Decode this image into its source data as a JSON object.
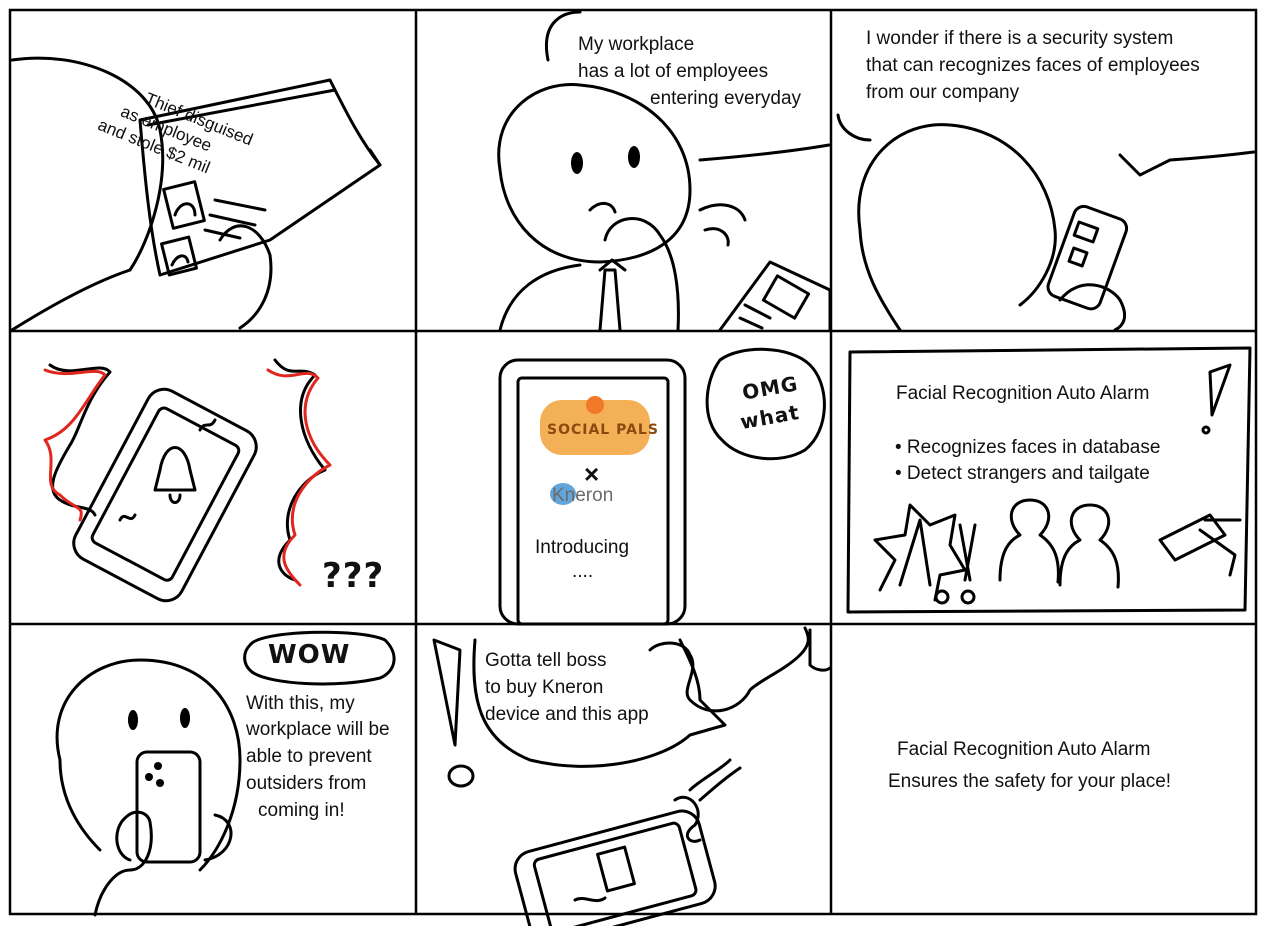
{
  "panel1": {
    "newspaper_headline": [
      "Thief disguised",
      "as employee",
      "and stole $2 mil"
    ]
  },
  "panel2": {
    "speech": [
      "My workplace",
      "has a lot of employees",
      "entering everyday"
    ]
  },
  "panel3": {
    "speech": [
      "I wonder if there is a security system",
      "that can recognizes faces of employees",
      "from our company"
    ]
  },
  "panel4": {
    "sound_text": "???"
  },
  "panel5": {
    "logo_socialpals": "SOCIAL PALS",
    "cross": "×",
    "logo_kneron": "Kneron",
    "caption": "Introducing",
    "ellipsis": "....",
    "thought": [
      "OMG",
      "what"
    ]
  },
  "panel6": {
    "title": "Facial Recognition Auto Alarm",
    "bullets": [
      "• Recognizes faces in database",
      "• Detect strangers and tailgate"
    ]
  },
  "panel7": {
    "bubble": "WOW",
    "text": [
      "With this, my",
      "workplace will be",
      "able to prevent",
      "outsiders from",
      "coming in!"
    ]
  },
  "panel8": {
    "speech": [
      "Gotta tell boss",
      "to buy Kneron",
      "device and this app"
    ]
  },
  "panel9": {
    "title": "Facial Recognition Auto Alarm",
    "tagline": "Ensures the safety for your place!"
  },
  "colors": {
    "ink": "#111111",
    "alert_red": "#e0261e",
    "logo_orange": "#f2a23a",
    "logo_blue": "#3a8fd1"
  }
}
